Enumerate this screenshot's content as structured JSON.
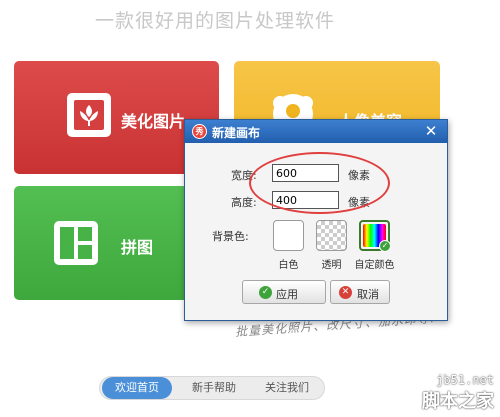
{
  "tagline": "一款很好用的图片处理软件",
  "tiles": {
    "meihua": {
      "label": "美化图片",
      "icon": "flower-frame-icon",
      "color": "#d43f3f"
    },
    "renxiang": {
      "label": "人像美容",
      "icon": "portrait-icon",
      "color": "#f2bb2c"
    },
    "pintu": {
      "label": "拼图",
      "icon": "layout-grid-icon",
      "color": "#47b346"
    }
  },
  "handwriting": "批量美化照片、改尺寸、加水印等!",
  "bottom_nav": {
    "items": [
      {
        "label": "欢迎首页",
        "active": true
      },
      {
        "label": "新手帮助",
        "active": false
      },
      {
        "label": "关注我们",
        "active": false
      }
    ]
  },
  "dialog": {
    "app_icon_text": "秀",
    "title": "新建画布",
    "close": "✕",
    "width_label": "宽度:",
    "width_value": "600",
    "height_label": "高度:",
    "height_value": "400",
    "unit": "像素",
    "background_label": "背景色:",
    "swatches": [
      {
        "caption": "白色",
        "selected": false
      },
      {
        "caption": "透明",
        "selected": false
      },
      {
        "caption": "自定颜色",
        "selected": true
      }
    ],
    "apply_label": "应用",
    "cancel_label": "取消"
  },
  "watermark": {
    "url": "jb51.net",
    "name": "脚本之家"
  },
  "colors": {
    "dialog_title_bar": "#2f6fc2",
    "nav_active": "#4a8fd8",
    "highlight_ring": "#e04040"
  }
}
